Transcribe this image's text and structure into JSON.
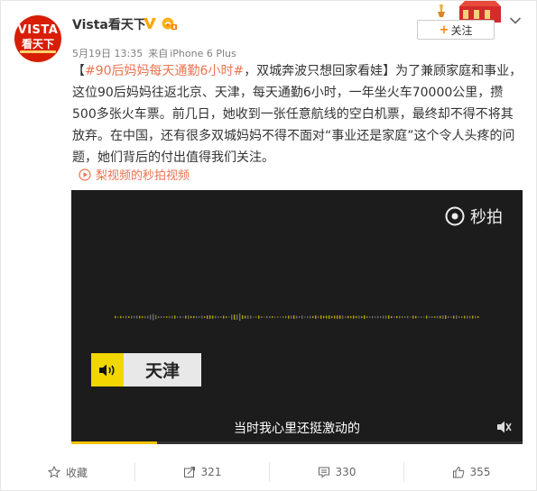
{
  "header": {
    "avatar_top": "VISTA",
    "avatar_bottom": "看天下",
    "username": "Vista看天下",
    "verified_icon": "verified-v-icon",
    "badge_icon": "gold-member-icon",
    "date": "5月19日 13:35",
    "source_prefix": "来自",
    "device": "iPhone 6 Plus",
    "follow_label": "关注",
    "menu_icon": "chevron-down-icon"
  },
  "post": {
    "hashtag": "#90后妈妈每天通勤6小时#",
    "body_open": "【",
    "body_rest": "，双城奔波只想回家看娃】为了兼顾家庭和事业，这位90后妈妈往返北京、天津，每天通勤6小时，一年坐火车70000公里，攒500多张火车票。前几日，她收到一张任意航线的空白机票，最终却不得不将其放弃。在中国，还有很多双城妈妈不得不面对“事业还是家庭”这个令人头疼的问题，她们背后的付出值得我们关注。",
    "video_link": "梨视频的秒拍视频"
  },
  "video": {
    "brand": "秒拍",
    "city_label": "天津",
    "subtitle": "当时我心里还挺激动的",
    "progress": 0.19,
    "colors": {
      "accent": "#f2d600",
      "background": "#1c1c1c"
    }
  },
  "actions": {
    "favorite": "收藏",
    "repost": "321",
    "comment": "330",
    "like": "355"
  },
  "colors": {
    "link": "#eb7350",
    "follow_plus": "#ff8200"
  }
}
